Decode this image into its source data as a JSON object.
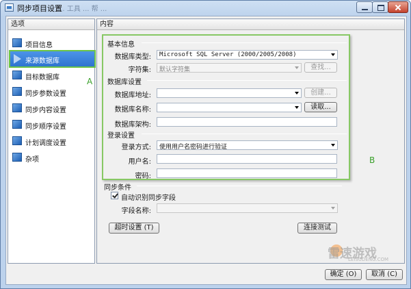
{
  "window": {
    "title": "同步项目设置",
    "ghost_title": "... 工具 ... 帮 ..."
  },
  "left_panel": {
    "header": "选项",
    "items": [
      {
        "label": "项目信息",
        "icon": "nav-page-icon"
      },
      {
        "label": "来源数据库",
        "icon": "selected-arrow-icon"
      },
      {
        "label": "目标数据库",
        "icon": "nav-page-icon"
      },
      {
        "label": "同步参数设置",
        "icon": "nav-page-icon"
      },
      {
        "label": "同步内容设置",
        "icon": "nav-page-icon"
      },
      {
        "label": "同步顺序设置",
        "icon": "nav-page-icon"
      },
      {
        "label": "计划调度设置",
        "icon": "nav-page-icon"
      },
      {
        "label": "杂项",
        "icon": "nav-page-icon"
      }
    ],
    "selected_index": 1
  },
  "annotations": {
    "a": "A",
    "b": "B",
    "color": "#39a02a"
  },
  "right_panel": {
    "header": "内容",
    "basic": {
      "title": "基本信息",
      "db_type_label": "数据库类型:",
      "db_type_value": "Microsoft SQL Server (2000/2005/2008)",
      "charset_label": "字符集:",
      "charset_value": "默认字符集",
      "find_button": "查找..."
    },
    "db_settings": {
      "title": "数据库设置",
      "address_label": "数据库地址:",
      "address_value": "",
      "create_button": "创建...",
      "name_label": "数据库名称:",
      "name_value": "",
      "read_button": "读取...",
      "schema_label": "数据库架构:",
      "schema_value": ""
    },
    "login": {
      "title": "登录设置",
      "method_label": "登录方式:",
      "method_value": "使用用户名密码进行验证",
      "username_label": "用户名:",
      "username_value": "",
      "password_label": "密码:",
      "password_value": ""
    },
    "sync": {
      "title": "同步条件",
      "auto_detect_label": "自动识别同步字段",
      "auto_detect_checked": true,
      "field_name_label": "字段名称:",
      "field_name_value": ""
    },
    "timeout_button": "超时设置 (T)",
    "test_button": "连接测试"
  },
  "footer": {
    "ok_button": "确定 (O)",
    "cancel_button": "取消 (C)",
    "watermark": "雷速游戏",
    "watermark_sub": "LEISUDENG.COM"
  }
}
